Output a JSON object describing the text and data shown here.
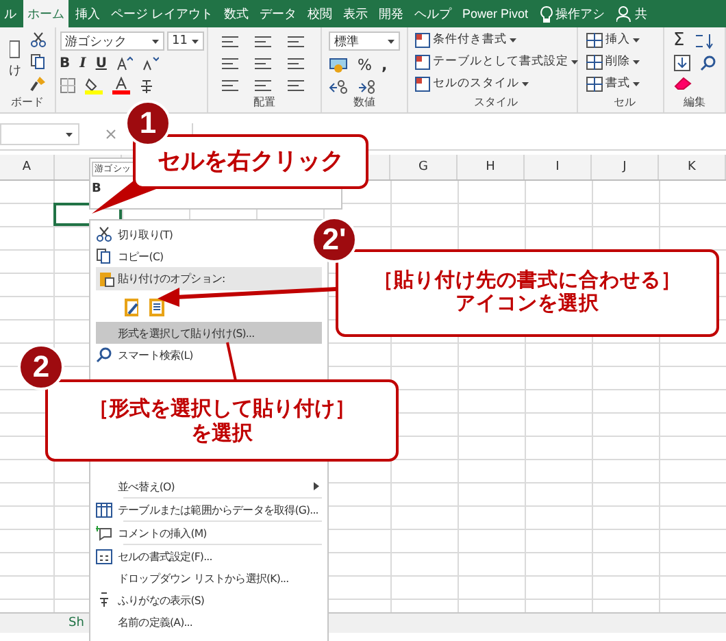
{
  "ribbon_tabs": [
    {
      "label": "ル",
      "selected": false,
      "kind": "tab"
    },
    {
      "label": "ホーム",
      "selected": true,
      "kind": "tab"
    },
    {
      "label": "挿入",
      "selected": false,
      "kind": "tab"
    },
    {
      "label": "ページ レイアウト",
      "selected": false,
      "kind": "tab"
    },
    {
      "label": "数式",
      "selected": false,
      "kind": "tab"
    },
    {
      "label": "データ",
      "selected": false,
      "kind": "tab"
    },
    {
      "label": "校閲",
      "selected": false,
      "kind": "tab"
    },
    {
      "label": "表示",
      "selected": false,
      "kind": "tab"
    },
    {
      "label": "開発",
      "selected": false,
      "kind": "tab"
    },
    {
      "label": "ヘルプ",
      "selected": false,
      "kind": "tab"
    },
    {
      "label": "Power Pivot",
      "selected": false,
      "kind": "tab"
    },
    {
      "label": "操作アシ",
      "selected": false,
      "kind": "tell"
    },
    {
      "label": "共",
      "selected": false,
      "kind": "share"
    }
  ],
  "ribbon": {
    "clipboard": {
      "label": "ボード",
      "paste_text": "け"
    },
    "font": {
      "font_name": "游ゴシック",
      "font_size": "11",
      "style_buttons": [
        "B",
        "I",
        "U"
      ]
    },
    "alignment": {
      "label": "配置"
    },
    "number": {
      "label": "数値",
      "format": "標準",
      "percent": "%",
      "comma": ","
    },
    "styles": {
      "label": "スタイル",
      "items": [
        "条件付き書式",
        "テーブルとして書式設定",
        "セルのスタイル"
      ]
    },
    "cells": {
      "label": "セル",
      "items": [
        "挿入",
        "削除",
        "書式"
      ]
    },
    "editing": {
      "label": "編集",
      "sum": "Σ"
    }
  },
  "columns_left": [
    "A"
  ],
  "columns_right": [
    "G",
    "H",
    "I",
    "J",
    "K"
  ],
  "mini_toolbar": {
    "font_name": "游ゴシッ",
    "bold": "B"
  },
  "context_menu": [
    {
      "kind": "cut",
      "label": "切り取り(T)",
      "highlighted": false
    },
    {
      "kind": "copy",
      "label": "コピー(C)",
      "highlighted": false
    },
    {
      "kind": "header",
      "label": "貼り付けのオプション:"
    },
    {
      "kind": "paste_icons"
    },
    {
      "kind": "plain",
      "label": "形式を選択して貼り付け(S)...",
      "highlighted": true
    },
    {
      "kind": "search",
      "label": "スマート検索(L)",
      "highlighted": false
    },
    {
      "kind": "gap"
    },
    {
      "kind": "plain",
      "label": "並べ替え(O)",
      "submenu": true,
      "highlighted": false
    },
    {
      "kind": "separator"
    },
    {
      "kind": "table",
      "label": "テーブルまたは範囲からデータを取得(G)...",
      "highlighted": false
    },
    {
      "kind": "separator"
    },
    {
      "kind": "comment",
      "label": "コメントの挿入(M)",
      "highlighted": false
    },
    {
      "kind": "separator"
    },
    {
      "kind": "format",
      "label": "セルの書式設定(F)...",
      "highlighted": false
    },
    {
      "kind": "plain",
      "label": "ドロップダウン リストから選択(K)...",
      "highlighted": false
    },
    {
      "kind": "furigana",
      "label": "ふりがなの表示(S)",
      "highlighted": false
    },
    {
      "kind": "plain",
      "label": "名前の定義(A)...",
      "highlighted": false
    }
  ],
  "callouts": [
    {
      "badge": "1",
      "lines": [
        "セルを右クリック"
      ],
      "kind": "one"
    },
    {
      "badge": "2'",
      "lines": [
        "［貼り付け先の書式に合わせる］",
        "アイコンを選択"
      ],
      "kind": "two_prime"
    },
    {
      "badge": "2",
      "lines": [
        "［形式を選択して貼り付け］",
        "を選択"
      ],
      "kind": "two"
    }
  ],
  "sheet_tab": "Sh"
}
